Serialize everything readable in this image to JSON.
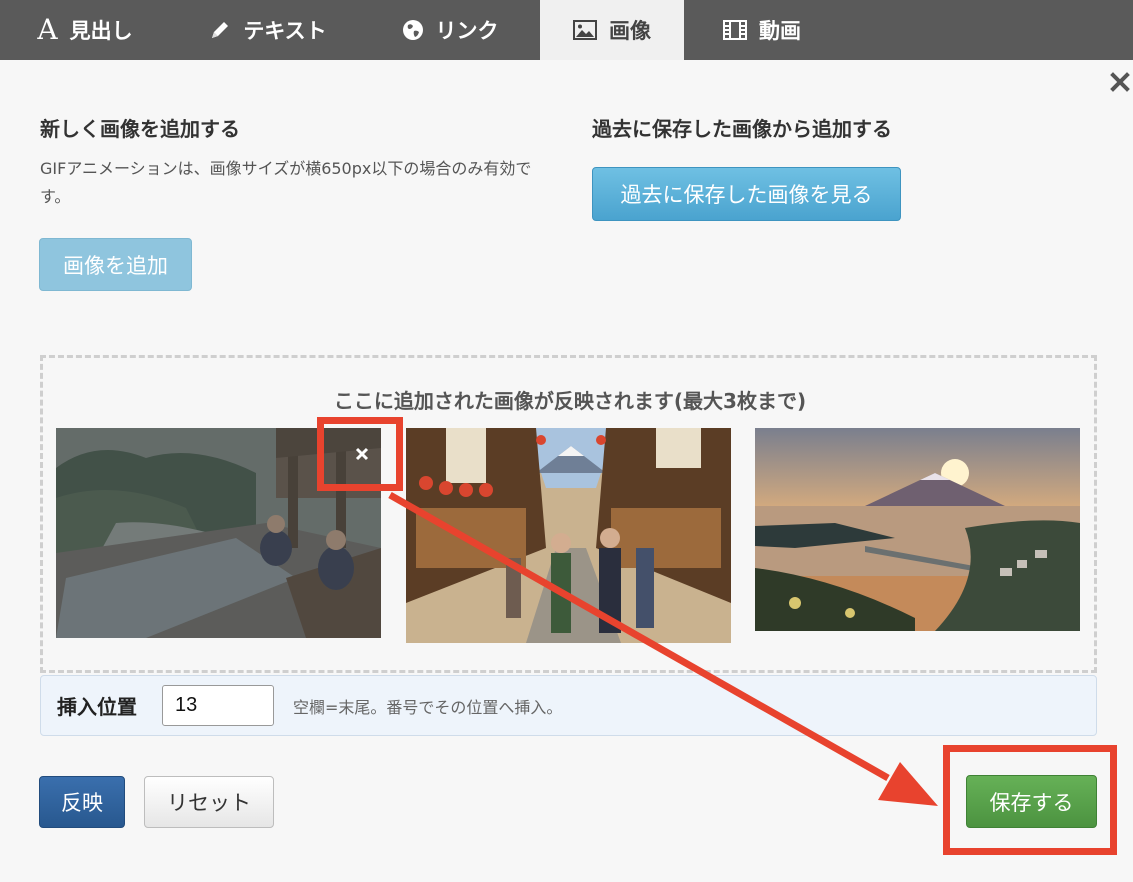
{
  "tabs": [
    {
      "label": "見出し",
      "icon": "heading-a-icon",
      "active": false
    },
    {
      "label": "テキスト",
      "icon": "pencil-icon",
      "active": false
    },
    {
      "label": "リンク",
      "icon": "globe-icon",
      "active": false
    },
    {
      "label": "画像",
      "icon": "image-icon",
      "active": true
    },
    {
      "label": "動画",
      "icon": "film-icon",
      "active": false
    }
  ],
  "new_image": {
    "title": "新しく画像を追加する",
    "note": "GIFアニメーションは、画像サイズが横650px以下の場合のみ有効です。",
    "add_button": "画像を追加"
  },
  "saved_image": {
    "title": "過去に保存した画像から追加する",
    "view_button": "過去に保存した画像を見る"
  },
  "dropzone": {
    "hint": "ここに追加された画像が反映されます(最大3枚まで)",
    "images": [
      {
        "subject": "hot-spring-bath",
        "dimmed": true
      },
      {
        "subject": "shopping-street-fuji",
        "dimmed": false
      },
      {
        "subject": "fuji-sunset-bay",
        "dimmed": false
      }
    ]
  },
  "insert_position": {
    "label": "挿入位置",
    "value": "13",
    "help": "空欄=末尾。番号でその位置へ挿入。"
  },
  "actions": {
    "apply": "反映",
    "reset": "リセット",
    "save": "保存する"
  },
  "colors": {
    "tabbar": "#5a5a5a",
    "annotation": "#e8432e",
    "save": "#55a048",
    "apply": "#2f6199"
  }
}
